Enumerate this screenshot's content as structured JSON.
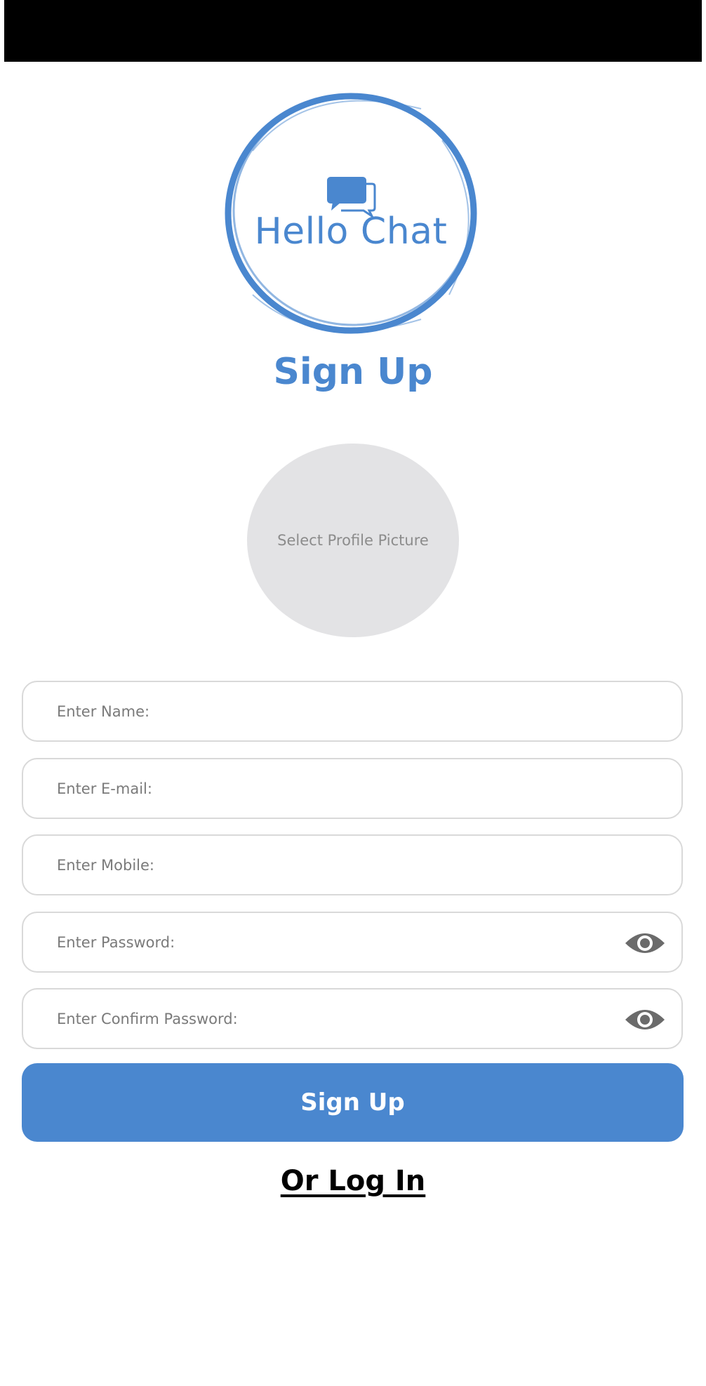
{
  "logo": {
    "text": "Hello Chat",
    "icon": "chat-bubbles-icon",
    "ring_color": "#4a87cf"
  },
  "title": "Sign Up",
  "profile_picture": {
    "label": "Select Profile Picture"
  },
  "fields": {
    "name": {
      "placeholder": "Enter Name:",
      "value": ""
    },
    "email": {
      "placeholder": "Enter E-mail:",
      "value": ""
    },
    "mobile": {
      "placeholder": "Enter Mobile:",
      "value": ""
    },
    "password": {
      "placeholder": "Enter Password:",
      "value": "",
      "toggle_icon": "eye-icon"
    },
    "confirm_password": {
      "placeholder": "Enter Confirm Password:",
      "value": "",
      "toggle_icon": "eye-icon"
    }
  },
  "submit_button": {
    "label": "Sign Up",
    "color": "#4a87cf"
  },
  "login_link": {
    "label": "Or Log In"
  }
}
